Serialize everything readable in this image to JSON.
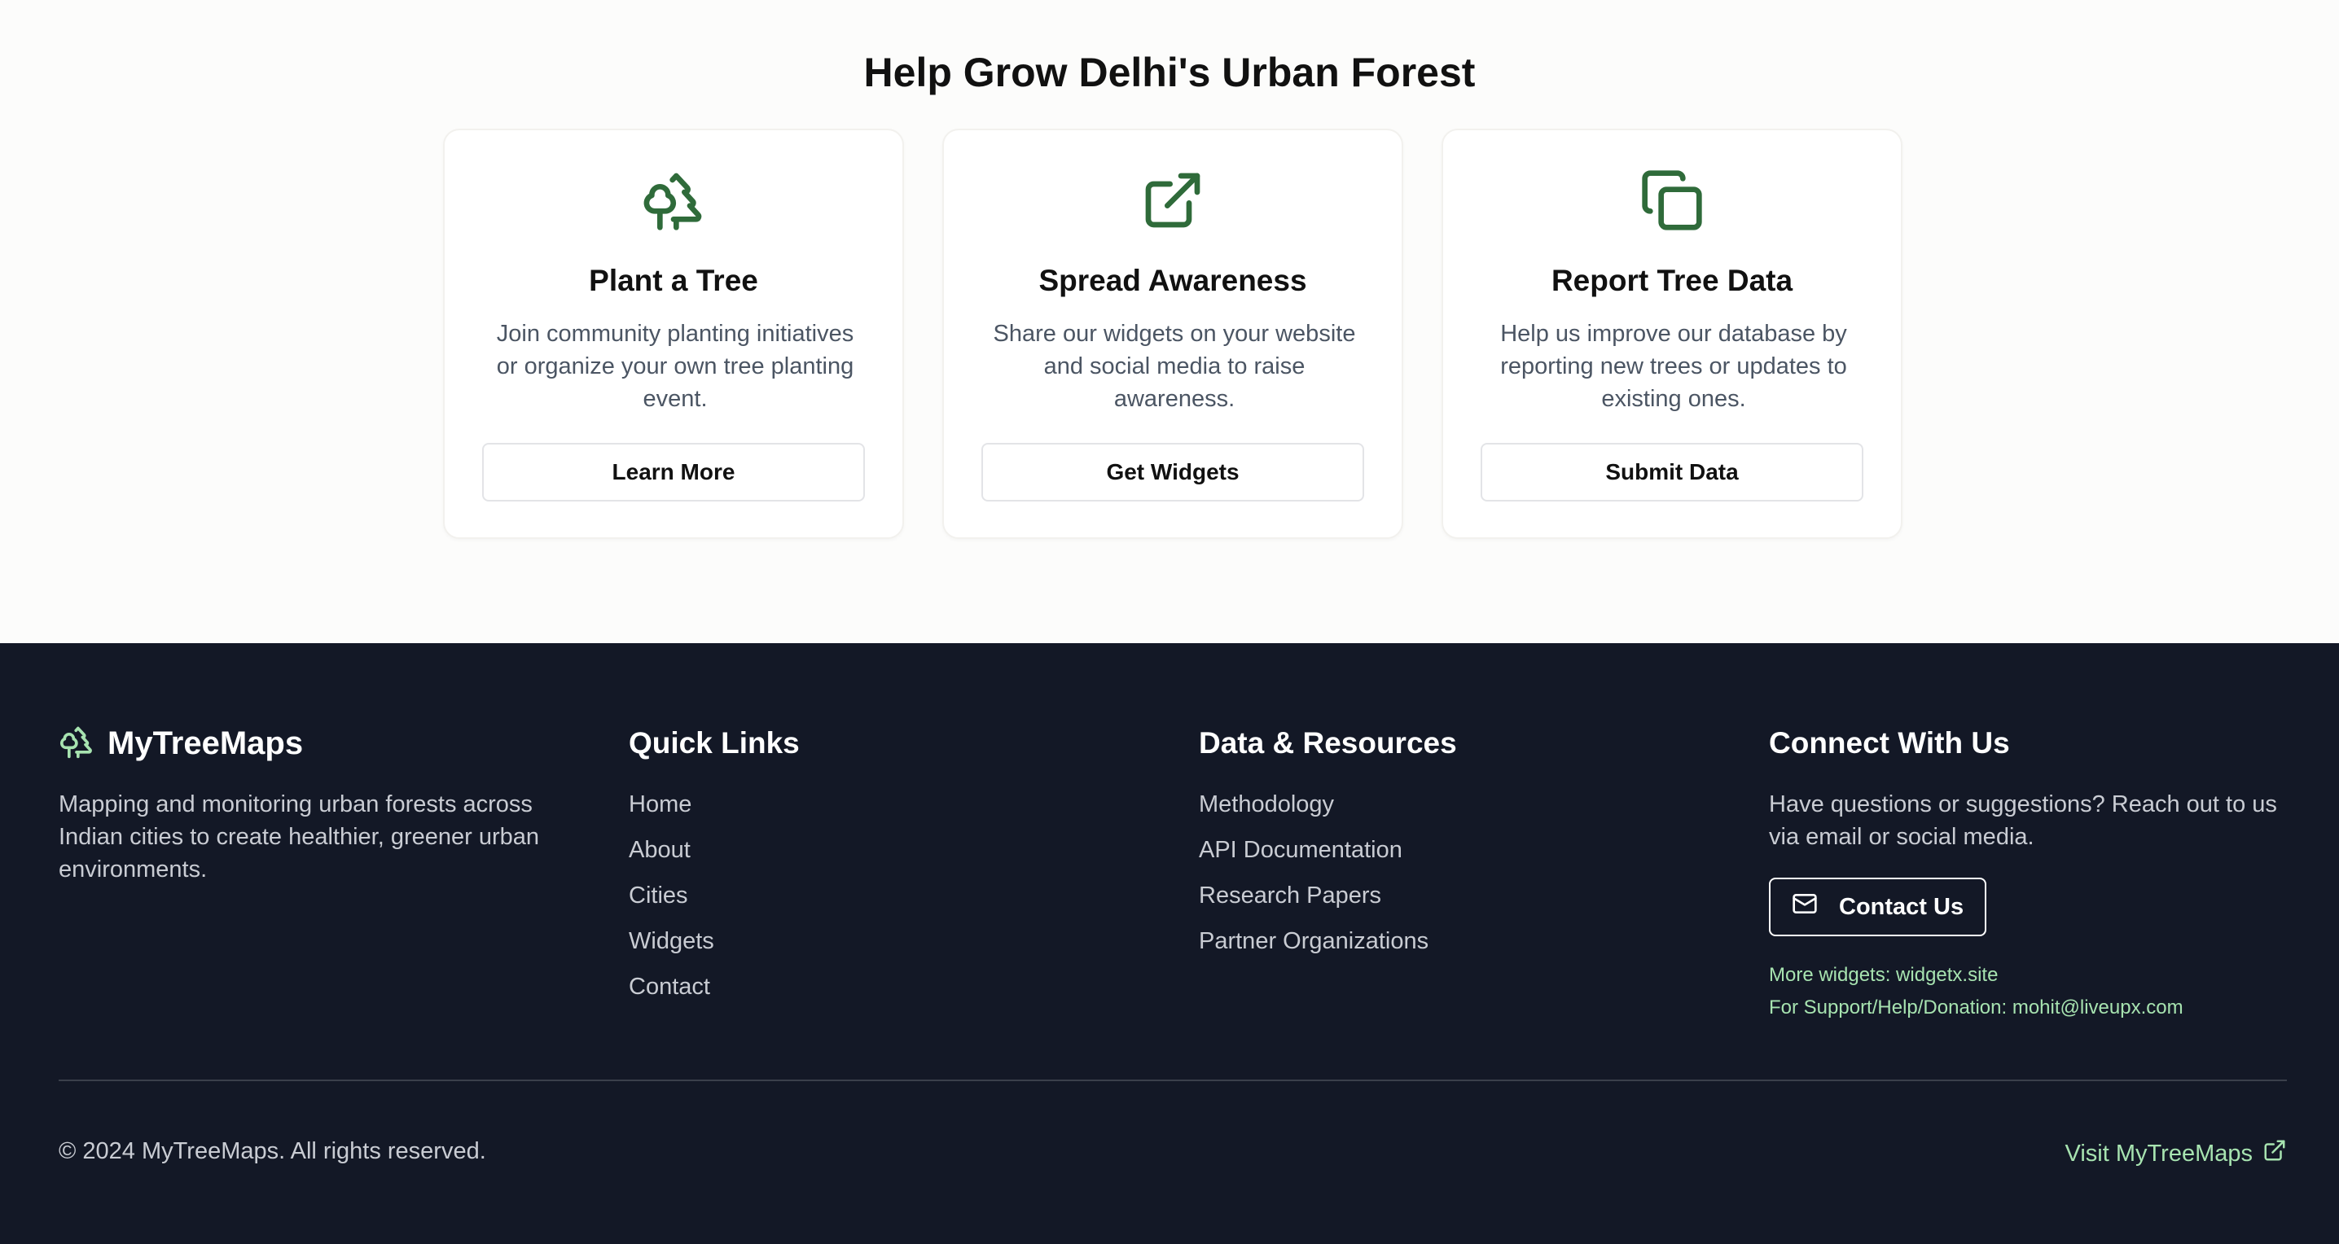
{
  "help": {
    "title": "Help Grow Delhi's Urban Forest",
    "cards": [
      {
        "icon": "trees-icon",
        "title": "Plant a Tree",
        "description": "Join community planting initiatives or organize your own tree planting event.",
        "button": "Learn More"
      },
      {
        "icon": "external-link-icon",
        "title": "Spread Awareness",
        "description": "Share our widgets on your website and social media to raise awareness.",
        "button": "Get Widgets"
      },
      {
        "icon": "copy-icon",
        "title": "Report Tree Data",
        "description": "Help us improve our database by reporting new trees or updates to existing ones.",
        "button": "Submit Data"
      }
    ]
  },
  "footer": {
    "brand": {
      "name": "MyTreeMaps",
      "icon": "trees-icon",
      "description": "Mapping and monitoring urban forests across Indian cities to create healthier, greener urban environments."
    },
    "quick_links": {
      "heading": "Quick Links",
      "items": [
        "Home",
        "About",
        "Cities",
        "Widgets",
        "Contact"
      ]
    },
    "resources": {
      "heading": "Data & Resources",
      "items": [
        "Methodology",
        "API Documentation",
        "Research Papers",
        "Partner Organizations"
      ]
    },
    "connect": {
      "heading": "Connect With Us",
      "description": "Have questions or suggestions? Reach out to us via email or social media.",
      "button": "Contact Us",
      "button_icon": "mail-icon",
      "more_widgets": "More widgets: widgetx.site",
      "support": "For Support/Help/Donation: mohit@liveupx.com"
    },
    "copyright": "© 2024 MyTreeMaps. All rights reserved.",
    "visit": "Visit MyTreeMaps",
    "visit_icon": "external-link-icon"
  },
  "colors": {
    "accent_green": "#2f6b3a",
    "footer_bg": "#131826",
    "footer_link_green": "#a7e3b0"
  }
}
